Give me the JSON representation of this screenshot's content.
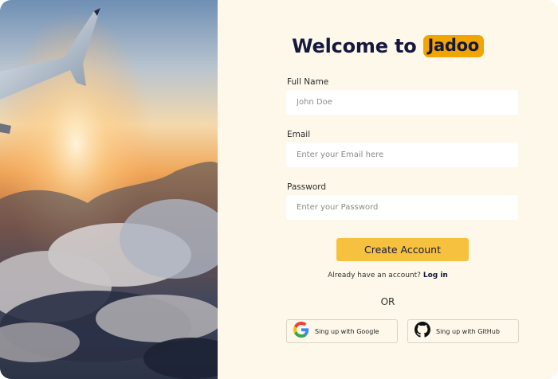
{
  "heading": {
    "welcome": "Welcome to",
    "brand": "Jadoo"
  },
  "form": {
    "full_name": {
      "label": "Full Name",
      "placeholder": "John Doe"
    },
    "email": {
      "label": "Email",
      "placeholder": "Enter your Email here"
    },
    "password": {
      "label": "Password",
      "placeholder": "Enter your Password"
    },
    "submit_label": "Create Account"
  },
  "login_prompt": {
    "text": "Already have an account?",
    "link": "Log in"
  },
  "divider_text": "OR",
  "social": {
    "google": {
      "label": "Sing up with Google",
      "icon": "google-icon"
    },
    "github": {
      "label": "Sing up with GitHub",
      "icon": "github-icon"
    }
  },
  "colors": {
    "brand_bg": "#f1a501",
    "cta_bg": "#f6c13f",
    "panel_bg": "#fdf8ea",
    "text_dark": "#14183e"
  }
}
